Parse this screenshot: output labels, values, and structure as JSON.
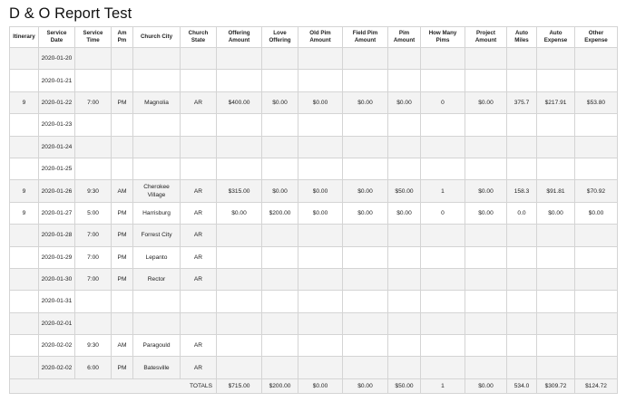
{
  "title": "D & O Report Test",
  "columns": [
    "Itinerary",
    "Service Date",
    "Service Time",
    "Am Pm",
    "Church City",
    "Church State",
    "Offering Amount",
    "Love Offering",
    "Old Pim Amount",
    "Field Pim Amount",
    "Pim Amount",
    "How Many Pims",
    "Project Amount",
    "Auto Miles",
    "Auto Expense",
    "Other Expense"
  ],
  "rows": [
    [
      "",
      "2020-01-20",
      "",
      "",
      "",
      "",
      "",
      "",
      "",
      "",
      "",
      "",
      "",
      "",
      "",
      ""
    ],
    [
      "",
      "2020-01-21",
      "",
      "",
      "",
      "",
      "",
      "",
      "",
      "",
      "",
      "",
      "",
      "",
      "",
      ""
    ],
    [
      "9",
      "2020-01-22",
      "7:00",
      "PM",
      "Magnolia",
      "AR",
      "$400.00",
      "$0.00",
      "$0.00",
      "$0.00",
      "$0.00",
      "0",
      "$0.00",
      "375.7",
      "$217.91",
      "$53.80"
    ],
    [
      "",
      "2020-01-23",
      "",
      "",
      "",
      "",
      "",
      "",
      "",
      "",
      "",
      "",
      "",
      "",
      "",
      ""
    ],
    [
      "",
      "2020-01-24",
      "",
      "",
      "",
      "",
      "",
      "",
      "",
      "",
      "",
      "",
      "",
      "",
      "",
      ""
    ],
    [
      "",
      "2020-01-25",
      "",
      "",
      "",
      "",
      "",
      "",
      "",
      "",
      "",
      "",
      "",
      "",
      "",
      ""
    ],
    [
      "9",
      "2020-01-26",
      "9:30",
      "AM",
      "Cherokee Village",
      "AR",
      "$315.00",
      "$0.00",
      "$0.00",
      "$0.00",
      "$50.00",
      "1",
      "$0.00",
      "158.3",
      "$91.81",
      "$70.92"
    ],
    [
      "9",
      "2020-01-27",
      "5:00",
      "PM",
      "Harrisburg",
      "AR",
      "$0.00",
      "$200.00",
      "$0.00",
      "$0.00",
      "$0.00",
      "0",
      "$0.00",
      "0.0",
      "$0.00",
      "$0.00"
    ],
    [
      "",
      "2020-01-28",
      "7:00",
      "PM",
      "Forrest City",
      "AR",
      "",
      "",
      "",
      "",
      "",
      "",
      "",
      "",
      "",
      ""
    ],
    [
      "",
      "2020-01-29",
      "7:00",
      "PM",
      "Lepanto",
      "AR",
      "",
      "",
      "",
      "",
      "",
      "",
      "",
      "",
      "",
      ""
    ],
    [
      "",
      "2020-01-30",
      "7:00",
      "PM",
      "Rector",
      "AR",
      "",
      "",
      "",
      "",
      "",
      "",
      "",
      "",
      "",
      ""
    ],
    [
      "",
      "2020-01-31",
      "",
      "",
      "",
      "",
      "",
      "",
      "",
      "",
      "",
      "",
      "",
      "",
      "",
      ""
    ],
    [
      "",
      "2020-02-01",
      "",
      "",
      "",
      "",
      "",
      "",
      "",
      "",
      "",
      "",
      "",
      "",
      "",
      ""
    ],
    [
      "",
      "2020-02-02",
      "9:30",
      "AM",
      "Paragould",
      "AR",
      "",
      "",
      "",
      "",
      "",
      "",
      "",
      "",
      "",
      ""
    ],
    [
      "",
      "2020-02-02",
      "6:00",
      "PM",
      "Batesville",
      "AR",
      "",
      "",
      "",
      "",
      "",
      "",
      "",
      "",
      "",
      ""
    ]
  ],
  "totals": {
    "label": "TOTALS",
    "values": [
      "$715.00",
      "$200.00",
      "$0.00",
      "$0.00",
      "$50.00",
      "1",
      "$0.00",
      "534.0",
      "$309.72",
      "$124.72"
    ]
  }
}
